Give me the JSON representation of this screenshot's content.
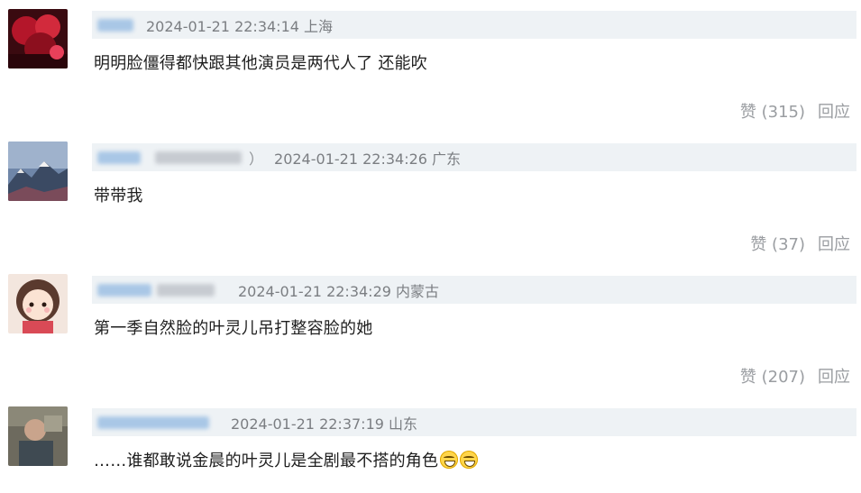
{
  "comments": [
    {
      "timestamp": "2024-01-21 22:34:14",
      "region": "上海",
      "text": "明明脸僵得都快跟其他演员是两代人了 还能吹",
      "like_label": "赞 (315)",
      "reply_label": "回应",
      "avatar_icon": "red-abstract-avatar-icon"
    },
    {
      "timestamp": "2024-01-21 22:34:26",
      "region": "广东",
      "text": "带带我",
      "like_label": "赞 (37)",
      "reply_label": "回应",
      "avatar_icon": "mountain-avatar-icon",
      "name_suffix": "）"
    },
    {
      "timestamp": "2024-01-21 22:34:29",
      "region": "内蒙古",
      "text": "第一季自然脸的叶灵儿吊打整容脸的她",
      "like_label": "赞 (207)",
      "reply_label": "回应",
      "avatar_icon": "cartoon-girl-avatar-icon"
    },
    {
      "timestamp": "2024-01-21 22:37:19",
      "region": "山东",
      "text": "……谁都敢说金晨的叶灵儿是全剧最不搭的角色",
      "like_label": "",
      "reply_label": "",
      "avatar_icon": "photo-avatar-icon",
      "emojis": [
        "grinning-sweat-emoji",
        "grinning-sweat-emoji"
      ]
    }
  ],
  "colors": {
    "meta_bar": "#eef2f5",
    "meta_text": "#7b7e82",
    "action_text": "#9a9da1",
    "content_text": "#1f1f1f",
    "username_blur": "#a9c7e6"
  }
}
